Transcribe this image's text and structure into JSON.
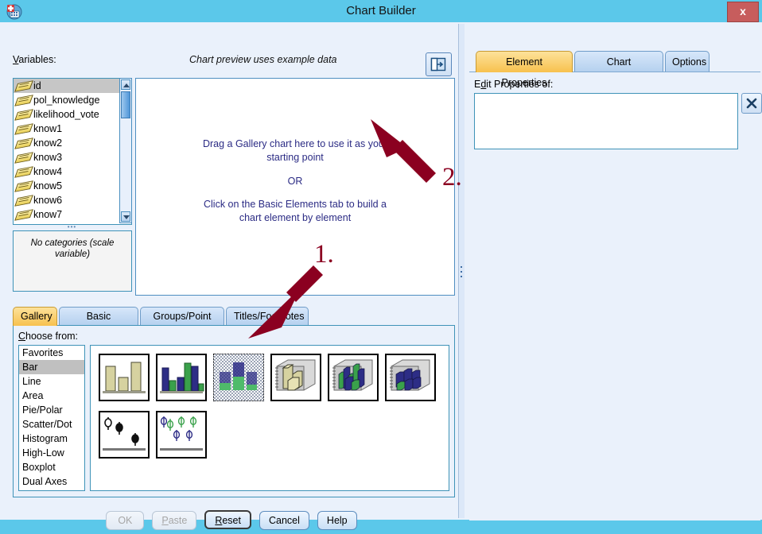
{
  "window": {
    "title": "Chart Builder",
    "icon": "spss-chart-builder-icon",
    "close_label": "x"
  },
  "left": {
    "variables_label": "Variables:",
    "preview_note": "Chart preview uses example data",
    "detach_icon": "detach-panel-icon",
    "variables": [
      {
        "name": "id",
        "measure_icon": "scale-ruler-icon",
        "selected": true
      },
      {
        "name": "pol_knowledge",
        "measure_icon": "scale-ruler-icon",
        "selected": false
      },
      {
        "name": "likelihood_vote",
        "measure_icon": "scale-ruler-icon",
        "selected": false
      },
      {
        "name": "know1",
        "measure_icon": "scale-ruler-icon",
        "selected": false
      },
      {
        "name": "know2",
        "measure_icon": "scale-ruler-icon",
        "selected": false
      },
      {
        "name": "know3",
        "measure_icon": "scale-ruler-icon",
        "selected": false
      },
      {
        "name": "know4",
        "measure_icon": "scale-ruler-icon",
        "selected": false
      },
      {
        "name": "know5",
        "measure_icon": "scale-ruler-icon",
        "selected": false
      },
      {
        "name": "know6",
        "measure_icon": "scale-ruler-icon",
        "selected": false
      },
      {
        "name": "know7",
        "measure_icon": "scale-ruler-icon",
        "selected": false
      }
    ],
    "categories_text": "No categories (scale variable)",
    "canvas": {
      "line1": "Drag a Gallery chart here to use it as your",
      "line2": "starting point",
      "or": "OR",
      "line3": "Click on the Basic Elements tab to build a",
      "line4": "chart element by element"
    },
    "tabs": [
      {
        "label": "Gallery",
        "active": true
      },
      {
        "label": "Basic Elements",
        "active": false
      },
      {
        "label": "Groups/Point ID",
        "active": false
      },
      {
        "label": "Titles/Footnotes",
        "active": false
      }
    ],
    "choose_from_label": "Choose from:",
    "choose_from": [
      {
        "label": "Favorites",
        "selected": false
      },
      {
        "label": "Bar",
        "selected": true
      },
      {
        "label": "Line",
        "selected": false
      },
      {
        "label": "Area",
        "selected": false
      },
      {
        "label": "Pie/Polar",
        "selected": false
      },
      {
        "label": "Scatter/Dot",
        "selected": false
      },
      {
        "label": "Histogram",
        "selected": false
      },
      {
        "label": "High-Low",
        "selected": false
      },
      {
        "label": "Boxplot",
        "selected": false
      },
      {
        "label": "Dual Axes",
        "selected": false
      }
    ],
    "gallery": [
      {
        "name": "simple-bar",
        "selected": false
      },
      {
        "name": "clustered-bar",
        "selected": false
      },
      {
        "name": "stacked-bar",
        "selected": true
      },
      {
        "name": "simple-3d-bar",
        "selected": false
      },
      {
        "name": "clustered-3d-bar",
        "selected": false
      },
      {
        "name": "stacked-3d-bar",
        "selected": false
      },
      {
        "name": "simple-error-bar",
        "selected": false
      },
      {
        "name": "clustered-error-bar",
        "selected": false
      }
    ],
    "buttons": [
      {
        "label": "OK",
        "enabled": false,
        "default": false
      },
      {
        "label": "Paste",
        "enabled": false,
        "default": false,
        "mnemonic": "P"
      },
      {
        "label": "Reset",
        "enabled": true,
        "default": true,
        "mnemonic": "R"
      },
      {
        "label": "Cancel",
        "enabled": true,
        "default": false
      },
      {
        "label": "Help",
        "enabled": true,
        "default": false
      }
    ]
  },
  "right": {
    "tabs": [
      {
        "label": "Element Properties",
        "active": true
      },
      {
        "label": "Chart Appearance",
        "active": false
      },
      {
        "label": "Options",
        "active": false
      }
    ],
    "edit_properties_label": "Edit Properties of:",
    "edit_properties_value": "",
    "close_icon": "close-x-icon"
  },
  "annotations": [
    {
      "label": "1.",
      "target": "stacked-bar-gallery-thumbnail"
    },
    {
      "label": "2.",
      "target": "chart-preview-canvas"
    }
  ],
  "colors": {
    "title_bar": "#5bc8ea",
    "window_bg": "#eaf1fb",
    "active_tab": "#f7c14e",
    "inactive_tab": "#b4d0ee",
    "annotation_red": "#8b0020",
    "canvas_text": "#2b2b84",
    "selection_gray": "#c6c6c6"
  }
}
